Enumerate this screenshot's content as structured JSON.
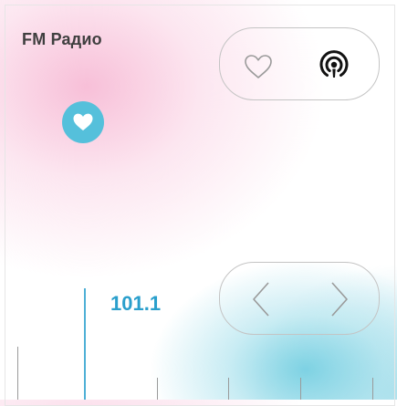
{
  "header": {
    "title": "FM Радио"
  },
  "top_controls": {
    "favorite_icon": "heart-outline-icon",
    "podcast_icon": "podcast-icon"
  },
  "favorite_badge": {
    "icon": "heart-icon",
    "color": "#55c0db"
  },
  "tuner": {
    "frequency": "101.1",
    "accent_color": "#2a9fcc"
  },
  "navigation": {
    "prev_icon": "chevron-left-icon",
    "next_icon": "chevron-right-icon"
  }
}
